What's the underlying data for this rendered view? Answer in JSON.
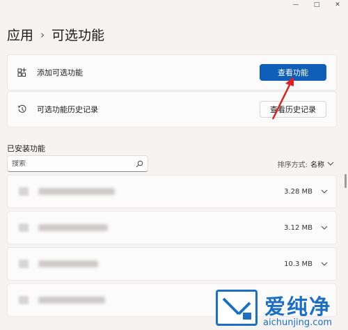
{
  "window_controls": {
    "minimize": "—",
    "maximize": "□",
    "close": "✕"
  },
  "breadcrumb": {
    "parent": "应用",
    "separator": "›",
    "current": "可选功能"
  },
  "add_feature": {
    "label": "添加可选功能",
    "button": "查看功能"
  },
  "history": {
    "label": "可选功能历史记录",
    "button": "查看历史记录"
  },
  "installed": {
    "title": "已安装功能",
    "search_placeholder": "搜索",
    "sort_label": "排序方式:",
    "sort_value": "名称",
    "items": [
      {
        "size": "3.28 MB"
      },
      {
        "size": "3.12 MB"
      },
      {
        "size": "10.3 MB"
      },
      {
        "size": ""
      }
    ]
  },
  "watermark": {
    "title": "爱纯净",
    "url": "aichunjing.com"
  },
  "colors": {
    "accent": "#0f5fb8",
    "annotation_arrow": "#e02020",
    "watermark": "#1b6fc4"
  }
}
